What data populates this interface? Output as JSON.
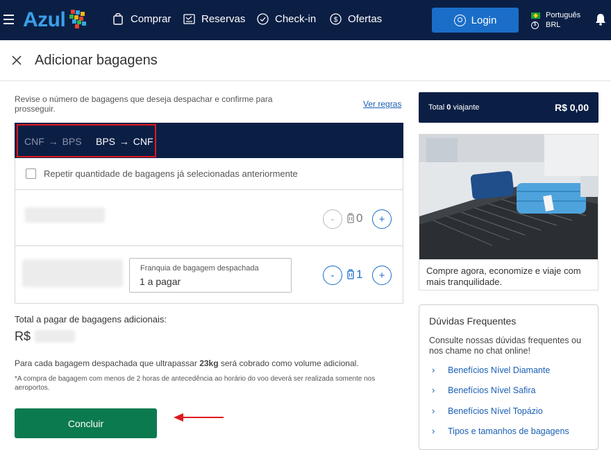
{
  "nav": {
    "brand": "Azul",
    "items": [
      {
        "label": "Comprar",
        "icon": "shopping-bag-icon"
      },
      {
        "label": "Reservas",
        "icon": "reservations-icon"
      },
      {
        "label": "Check-in",
        "icon": "check-circle-icon"
      },
      {
        "label": "Ofertas",
        "icon": "dollar-circle-icon"
      }
    ],
    "login_label": "Login",
    "language": "Português",
    "currency": "BRL",
    "colors": {
      "bar": "#0b1f45",
      "login": "#1a6ec7",
      "logo": "#3aa0e8"
    }
  },
  "header": {
    "title": "Adicionar bagagens"
  },
  "intro": {
    "text": "Revise o número de bagagens que deseja despachar e confirme para prosseguir.",
    "rules_link": "Ver regras"
  },
  "tabs": [
    {
      "label": "CNF → BPS",
      "from": "CNF",
      "to": "BPS",
      "active": false
    },
    {
      "label": "BPS → CNF",
      "from": "BPS",
      "to": "CNF",
      "active": true
    }
  ],
  "repeat_checkbox": {
    "label": "Repetir quantidade de bagagens já selecionadas anteriormente",
    "checked": false
  },
  "passengers": [
    {
      "count": "0",
      "minus": "-",
      "plus": "+"
    },
    {
      "count": "1",
      "minus": "-",
      "plus": "+",
      "allowance_label": "Franquia de bagagem despachada",
      "allowance_value": "1 a pagar"
    }
  ],
  "totals": {
    "label": "Total a pagar de bagagens adicionais:",
    "currency": "R$"
  },
  "notes": {
    "weight_prefix": "Para cada bagagem despachada que ultrapassar ",
    "weight_value": "23kg",
    "weight_suffix": " será cobrado como volume adicional.",
    "small": "*A compra de bagagem com menos de 2 horas de antecedência ao horário do voo deverá ser realizada somente nos aeroportos."
  },
  "conclude_label": "Concluir",
  "summary": {
    "total_prefix": "Total ",
    "travelers_count": "0",
    "travelers_suffix": " viajante",
    "amount": "R$ 0,00"
  },
  "promo": {
    "text": "Compre agora, economize e viaje com mais tranquilidade."
  },
  "faq": {
    "title": "Dúvidas Frequentes",
    "description": "Consulte nossas dúvidas frequentes ou nos chame no chat online!",
    "items": [
      "Benefícios Nível Diamante",
      "Benefícios Nível Safira",
      "Benefícios Nível Topázio",
      "Tipos e tamanhos de bagagens"
    ]
  },
  "accent_colors": {
    "primary": "#1a6ec7",
    "conclude": "#0b7a4e",
    "highlight": "#e0181e"
  }
}
